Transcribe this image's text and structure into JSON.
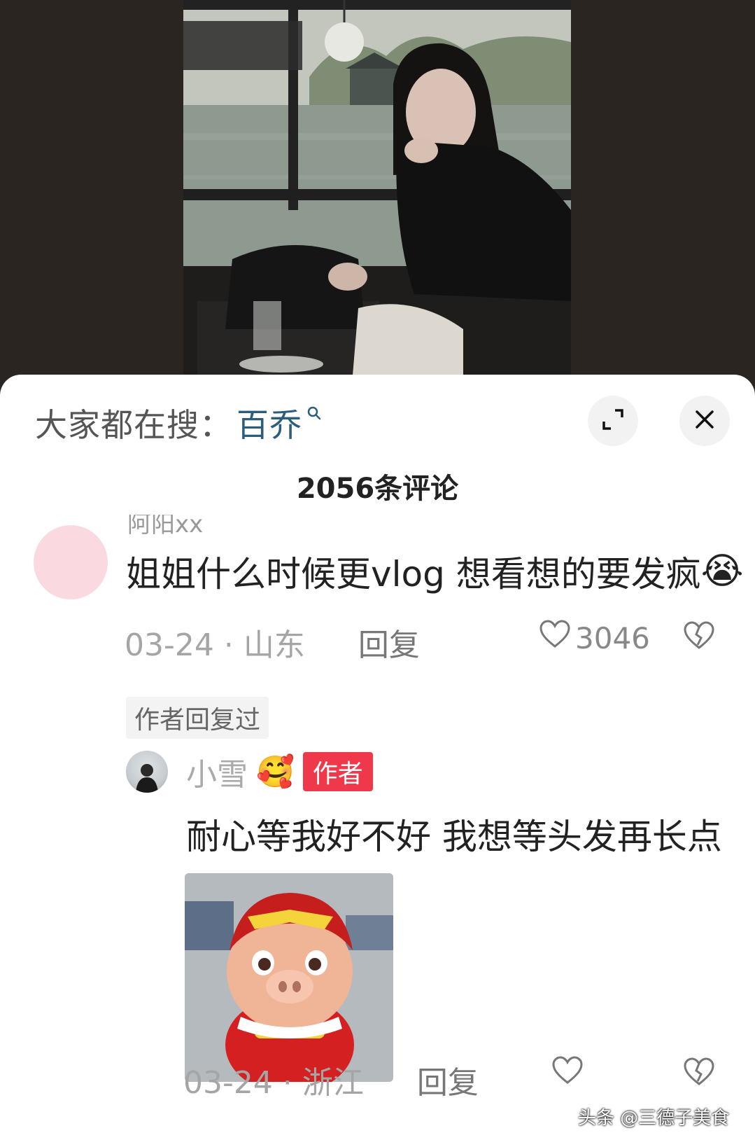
{
  "search": {
    "prefix": "大家都在搜：",
    "term": "百乔"
  },
  "comments_header": {
    "title": "2056条评论"
  },
  "comment": {
    "username": "阿阳xx",
    "text": "姐姐什么时候更vlog  想看想的要发疯",
    "emoji": "😭",
    "date": "03-24",
    "location": "山东",
    "reply_label": "回复",
    "likes": "3046",
    "author_replied_label": "作者回复过"
  },
  "reply": {
    "username": "小雪",
    "emoji": "🥰",
    "author_tag": "作者",
    "text": "耐心等我好不好 我想等头发再长点",
    "date": "03-24",
    "location": "浙江",
    "reply_label": "回复"
  },
  "watermark": {
    "text": "头条 @三德子美食"
  },
  "colors": {
    "accent": "#2c5d7c",
    "author_tag": "#f0384b",
    "sheet_bg": "#ffffff",
    "video_bg": "#2a2520"
  },
  "icons": [
    "expand-icon",
    "close-icon",
    "search-icon",
    "heart-icon",
    "broken-heart-icon"
  ]
}
